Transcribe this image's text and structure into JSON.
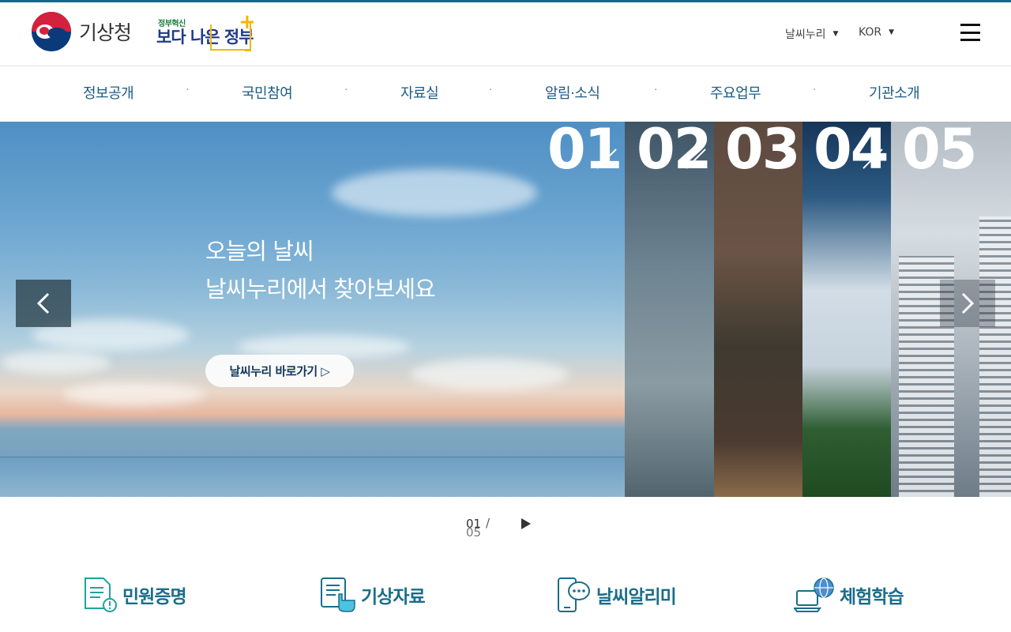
{
  "header": {
    "logo_text": "기상청",
    "gov_slogan_small": "정부혁신",
    "gov_slogan_big": "보다 나은 정부",
    "util_weather": "날씨누리",
    "util_lang": "KOR"
  },
  "nav": {
    "items": [
      "정보공개",
      "국민참여",
      "자료실",
      "알림·소식",
      "주요업무",
      "기관소개"
    ],
    "separator": "·"
  },
  "hero": {
    "line1": "오늘의 날씨",
    "line2": "날씨누리에서 찾아보세요",
    "button": "날씨누리 바로가기 ▷",
    "numbers": [
      "01",
      "02",
      "03",
      "04",
      "05"
    ]
  },
  "pager": {
    "current": "01",
    "separator": "/",
    "total": "05"
  },
  "quick_links": [
    "민원증명",
    "기상자료",
    "날씨알리미",
    "체험학습"
  ],
  "colors": {
    "accent": "#0a6b8f",
    "nav_text": "#1b5c86",
    "quick_text": "#1b6d8a",
    "gov_yellow": "#f2b705"
  }
}
